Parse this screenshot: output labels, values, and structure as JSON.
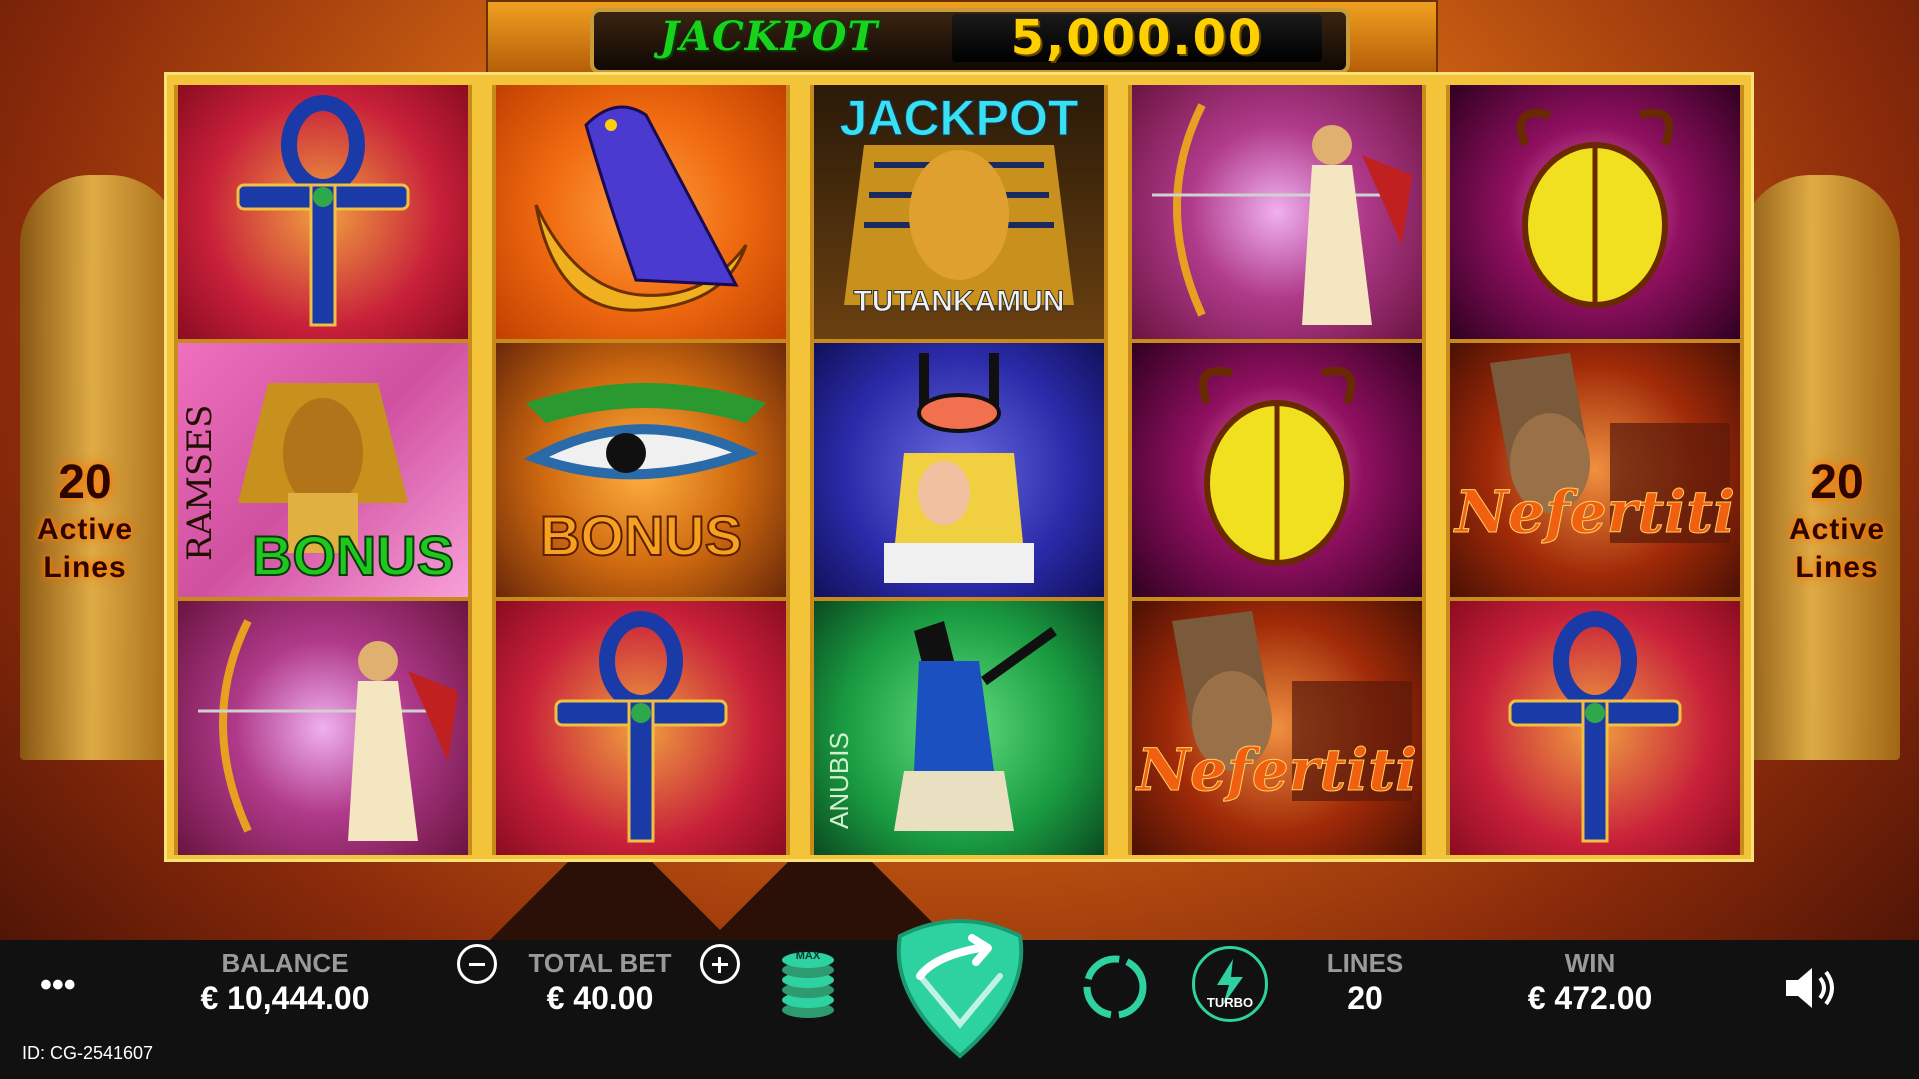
{
  "jackpot": {
    "label": "JACKPOT",
    "value": "5,000.00"
  },
  "side_panels": {
    "lines_count": "20",
    "lines_label_1": "Active",
    "lines_label_2": "Lines"
  },
  "reels": [
    [
      "ankh",
      "ramses-bonus",
      "archer"
    ],
    [
      "falcon",
      "eye-bonus",
      "ankh"
    ],
    [
      "tutankamun-jackpot",
      "isis",
      "anubis"
    ],
    [
      "archer",
      "scarab",
      "nefertiti"
    ],
    [
      "scarab",
      "nefertiti",
      "ankh"
    ]
  ],
  "symbol_text": {
    "ramses": "RAMSES",
    "bonus": "BONUS",
    "jackpot": "JACKPOT",
    "tutankamun": "TUTANKAMUN",
    "nefertiti": "Nefertiti",
    "anubis": "ANUBIS"
  },
  "bottom_bar": {
    "balance_label": "BALANCE",
    "balance_value": "€ 10,444.00",
    "total_bet_label": "TOTAL BET",
    "total_bet_value": "€ 40.00",
    "max_label": "MAX",
    "turbo_label": "TURBO",
    "lines_label": "LINES",
    "lines_value": "20",
    "win_label": "WIN",
    "win_value": "€ 472.00",
    "game_id": "ID: CG-2541607"
  },
  "colors": {
    "accent": "#2ed2a0",
    "jackpot_green": "#19d21c",
    "jackpot_value": "#ffd000"
  }
}
